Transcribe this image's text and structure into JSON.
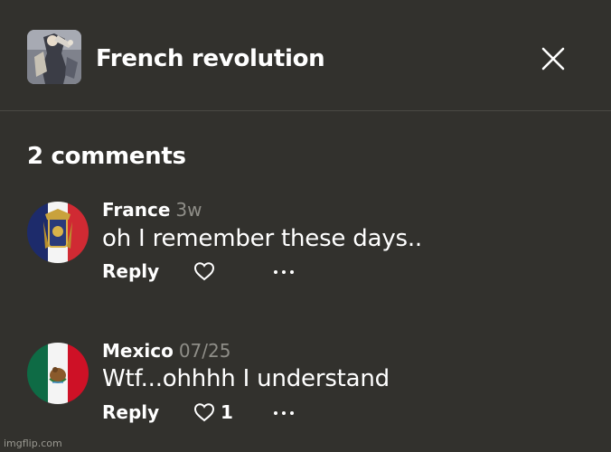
{
  "header": {
    "title": "French revolution",
    "thumbnail": "meme-thumbnail",
    "close_icon": "close-icon"
  },
  "comments_count": "2 comments",
  "comments": [
    {
      "author": "France",
      "time": "3w",
      "text": "oh I remember these days..",
      "reply_label": "Reply",
      "like_count": "",
      "avatar": "france-flag-avatar"
    },
    {
      "author": "Mexico",
      "time": "07/25",
      "text": "Wtf...ohhhh I understand",
      "reply_label": "Reply",
      "like_count": "1",
      "avatar": "mexico-flag-avatar"
    }
  ],
  "watermark": "imgflip.com",
  "colors": {
    "background": "#32312d",
    "text": "#ffffff",
    "muted": "#8f8e88",
    "divider": "#4a4944"
  }
}
